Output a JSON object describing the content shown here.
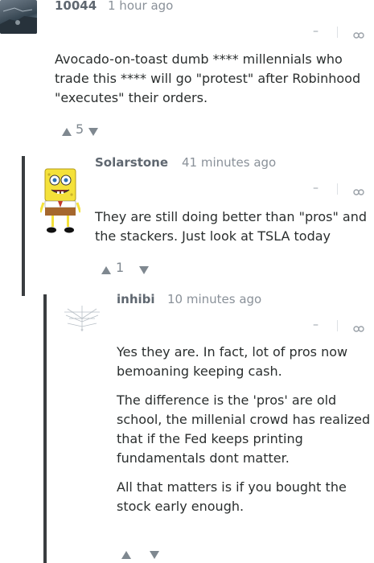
{
  "comments": [
    {
      "author": "10044",
      "time": "1 hour ago",
      "paragraphs": [
        "Avocado-on-toast dumb **** millennials who trade this **** will go \"protest\" after Robinhood \"executes\" their orders."
      ],
      "votes": "5"
    },
    {
      "author": "Solarstone",
      "time": "41 minutes ago",
      "paragraphs": [
        "They are still doing better than \"pros\" and the stackers. Just look at TSLA today"
      ],
      "votes": "1"
    },
    {
      "author": "inhibi",
      "time": "10 minutes ago",
      "paragraphs": [
        "Yes they are. In fact, lot of pros now bemoaning keeping cash.",
        "The difference is the 'pros' are old school, the millenial crowd has realized that if the Fed keeps printing fundamentals dont matter.",
        "All that matters is if you bought the stock early enough."
      ],
      "votes": ""
    }
  ],
  "controls": {
    "collapse": "–",
    "link": "⁠"
  },
  "icons": {
    "upvote": "upvote-icon",
    "downvote": "downvote-icon",
    "link": "link-icon"
  },
  "colors": {
    "thread_line": "#3a3d40",
    "author": "#5f6770",
    "meta": "#8a9199"
  }
}
